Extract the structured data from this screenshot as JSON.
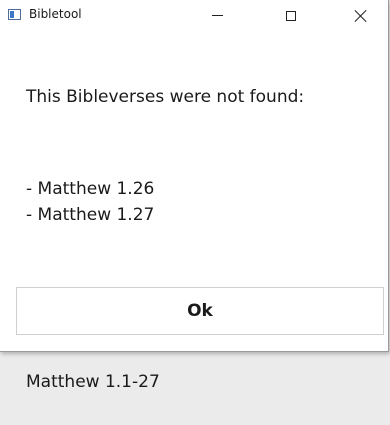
{
  "window": {
    "title": "Bibletool",
    "icon": "app-window-icon"
  },
  "caption_buttons": {
    "minimize_icon": "minimize-icon",
    "maximize_icon": "maximize-icon",
    "close_icon": "close-icon"
  },
  "dialog": {
    "message": "This Bibleverses were not found:",
    "verses": [
      "- Matthew 1.26",
      "- Matthew 1.27"
    ],
    "ok_label": "Ok"
  },
  "background": {
    "text": "Matthew 1.1-27"
  },
  "colors": {
    "dialog_bg": "#ffffff",
    "page_bg": "#ebebeb",
    "text": "#1a1a1a"
  }
}
